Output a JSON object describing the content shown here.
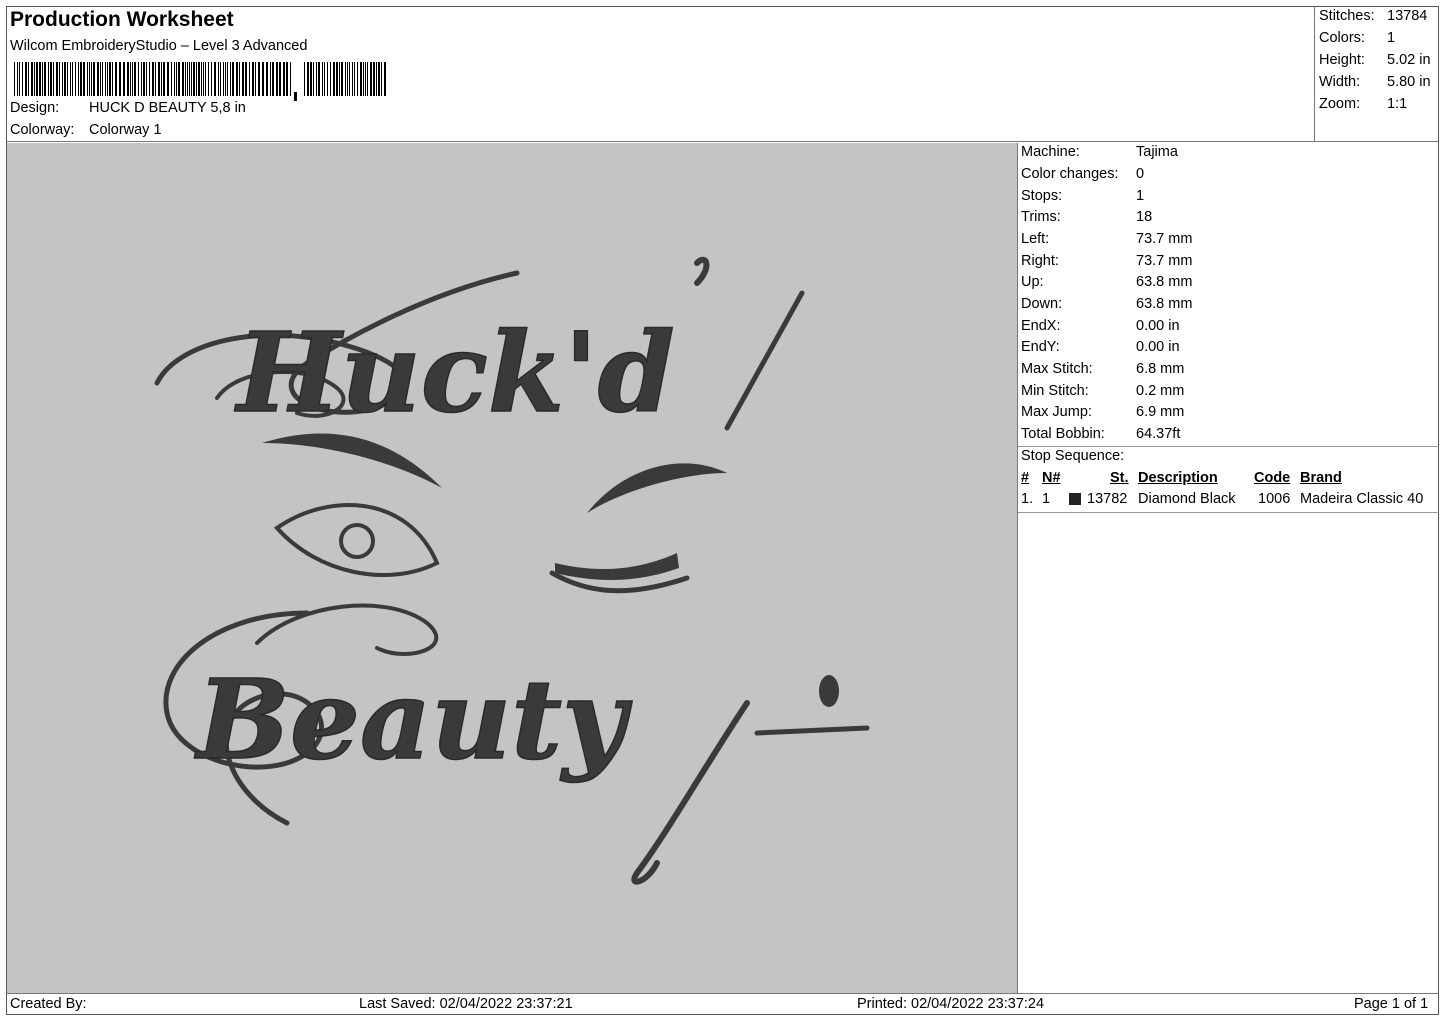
{
  "header": {
    "title": "Production Worksheet",
    "software": "Wilcom EmbroideryStudio – Level 3 Advanced",
    "design_label": "Design:",
    "design_value": "HUCK D BEAUTY 5,8 in",
    "colorway_label": "Colorway:",
    "colorway_value": "Colorway 1"
  },
  "stats": {
    "stitches_label": "Stitches:",
    "stitches_value": "13784",
    "colors_label": "Colors:",
    "colors_value": "1",
    "height_label": "Height:",
    "height_value": "5.02 in",
    "width_label": "Width:",
    "width_value": "5.80 in",
    "zoom_label": "Zoom:",
    "zoom_value": "1:1"
  },
  "design": {
    "line1": "Huck'd",
    "line2": "Beauty",
    "thread_color": "#3a3a38",
    "background_color": "#c4c4c4"
  },
  "info": {
    "machine": {
      "label": "Machine:",
      "value": "Tajima"
    },
    "color_changes": {
      "label": "Color changes:",
      "value": "0"
    },
    "stops": {
      "label": "Stops:",
      "value": "1"
    },
    "trims": {
      "label": "Trims:",
      "value": "18"
    },
    "left": {
      "label": "Left:",
      "value": "73.7 mm"
    },
    "right": {
      "label": "Right:",
      "value": "73.7 mm"
    },
    "up": {
      "label": "Up:",
      "value": "63.8 mm"
    },
    "down": {
      "label": "Down:",
      "value": "63.8 mm"
    },
    "endx": {
      "label": "EndX:",
      "value": "0.00 in"
    },
    "endy": {
      "label": "EndY:",
      "value": "0.00 in"
    },
    "max_stitch": {
      "label": "Max Stitch:",
      "value": "6.8 mm"
    },
    "min_stitch": {
      "label": "Min Stitch:",
      "value": "0.2 mm"
    },
    "max_jump": {
      "label": "Max Jump:",
      "value": "6.9 mm"
    },
    "total_bobbin": {
      "label": "Total Bobbin:",
      "value": "64.37ft"
    }
  },
  "stop_sequence": {
    "title": "Stop Sequence:",
    "headers": {
      "num": "#",
      "n": "N#",
      "st": "St.",
      "description": "Description",
      "code": "Code",
      "brand": "Brand"
    },
    "rows": [
      {
        "num": "1.",
        "n": "1",
        "swatch": "#222222",
        "st": "13782",
        "description": "Diamond Black",
        "code": "1006",
        "brand": "Madeira Classic 40"
      }
    ]
  },
  "footer": {
    "created_by": "Created By:",
    "last_saved": "Last Saved: 02/04/2022 23:37:21",
    "printed": "Printed: 02/04/2022 23:37:24",
    "page": "Page 1 of 1"
  }
}
